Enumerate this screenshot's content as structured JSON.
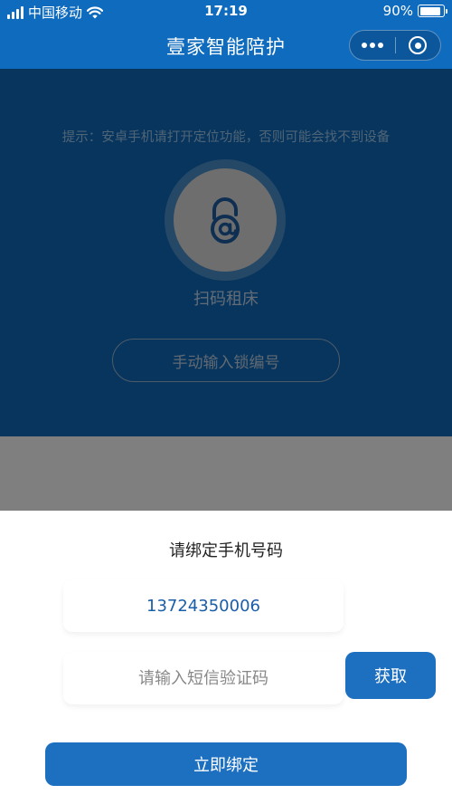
{
  "status_bar": {
    "carrier": "中国移动",
    "time": "17:19",
    "battery_percent": "90%",
    "battery_level": 0.9
  },
  "nav": {
    "title": "壹家智能陪护"
  },
  "main": {
    "hint": "提示：安卓手机请打开定位功能，否则可能会找不到设备",
    "scan_label": "扫码租床",
    "manual_button": "手动输入锁编号"
  },
  "sheet": {
    "title": "请绑定手机号码",
    "phone_number": "13724350006",
    "code_placeholder": "请输入短信验证码",
    "get_code_button": "获取",
    "bind_button": "立即绑定"
  },
  "colors": {
    "brand": "#0f6bbd",
    "button": "#1d6fc0",
    "phone_text": "#1a5ea8"
  },
  "icons": {
    "scan": "lock-at-icon",
    "wifi": "wifi-icon",
    "more": "more-dots-icon",
    "close": "mini-program-close-icon"
  }
}
